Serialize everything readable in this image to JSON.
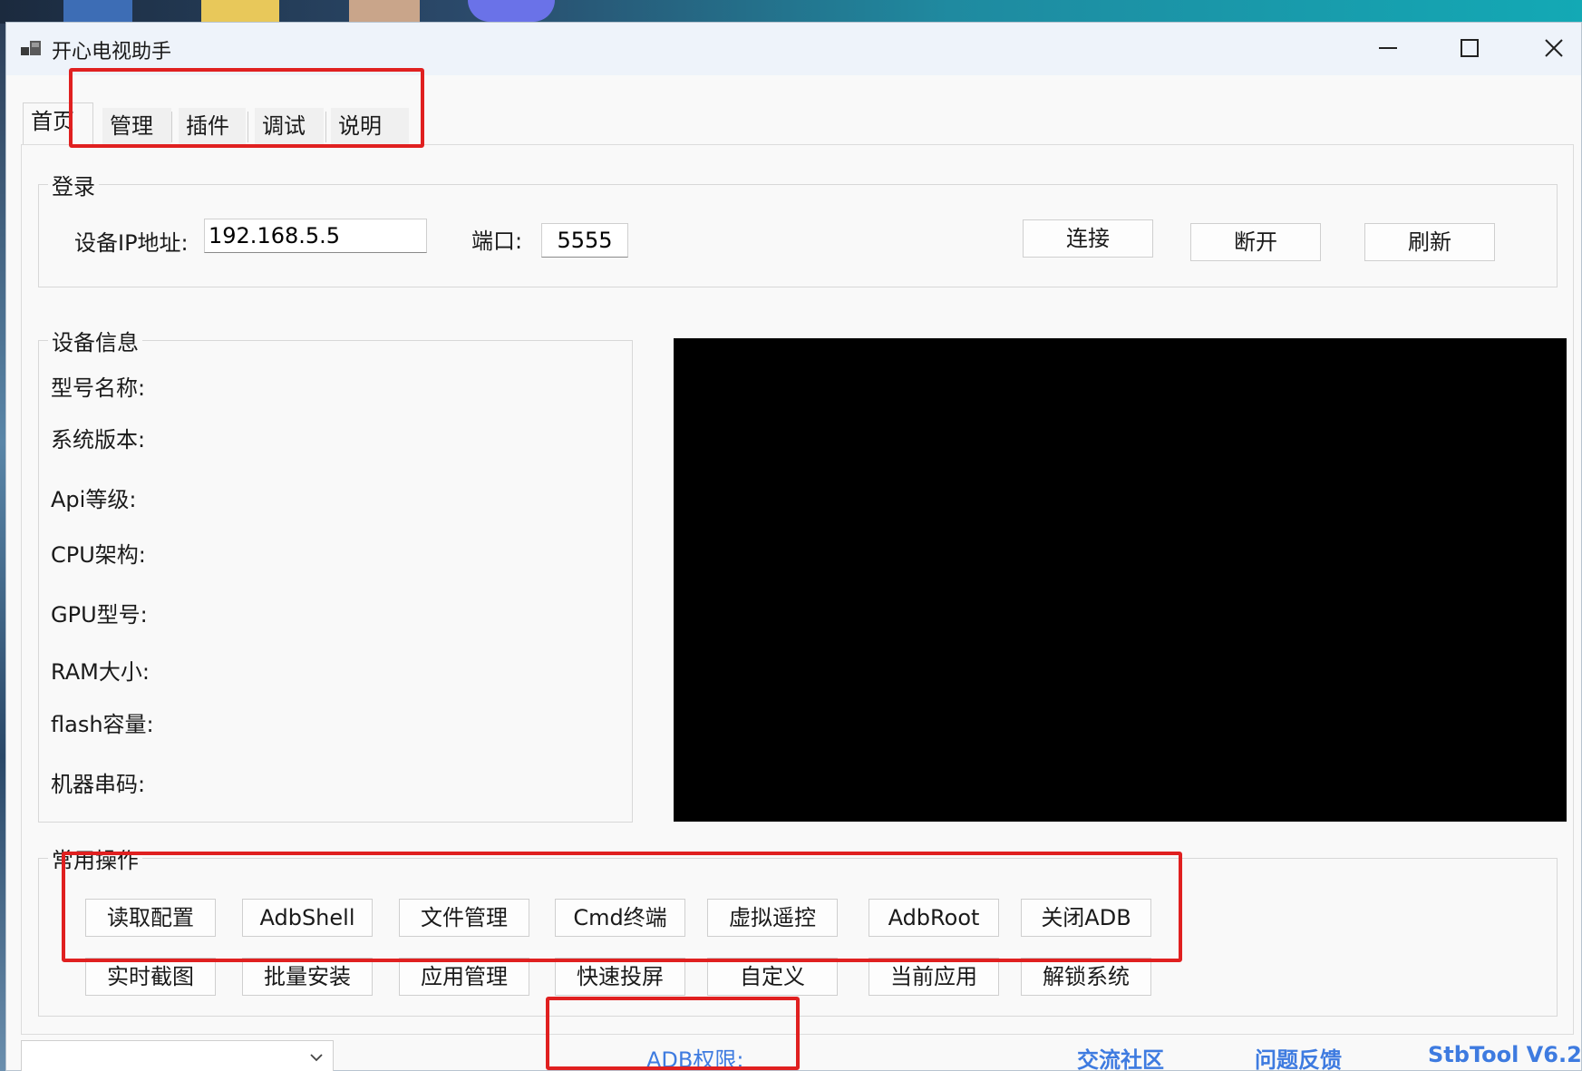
{
  "window": {
    "title": "开心电视助手"
  },
  "tabs": [
    {
      "label": "首页",
      "active": true
    },
    {
      "label": "管理"
    },
    {
      "label": "插件"
    },
    {
      "label": "调试"
    },
    {
      "label": "说明"
    }
  ],
  "login": {
    "group_title": "登录",
    "ip_label": "设备IP地址:",
    "ip_value": "192.168.5.5",
    "port_label": "端口:",
    "port_value": "5555",
    "connect_label": "连接",
    "disconnect_label": "断开",
    "refresh_label": "刷新"
  },
  "device_info": {
    "group_title": "设备信息",
    "fields": [
      "型号名称:",
      "系统版本:",
      "Api等级:",
      "CPU架构:",
      "GPU型号:",
      "RAM大小:",
      "flash容量:",
      "机器串码:"
    ]
  },
  "operations": {
    "group_title": "常用操作",
    "row1": [
      "读取配置",
      "AdbShell",
      "文件管理",
      "Cmd终端",
      "虚拟遥控",
      "AdbRoot",
      "关闭ADB"
    ],
    "row2": [
      "实时截图",
      "批量安装",
      "应用管理",
      "快速投屏",
      "自定义",
      "当前应用",
      "解锁系统"
    ]
  },
  "status": {
    "adb_label": "ADB权限:",
    "community_link": "交流社区",
    "feedback_link": "问题反馈",
    "version": "StbTool V6.2"
  },
  "colors": {
    "highlight": "#e02020",
    "link": "#3e7be0",
    "preview": "#000000"
  }
}
